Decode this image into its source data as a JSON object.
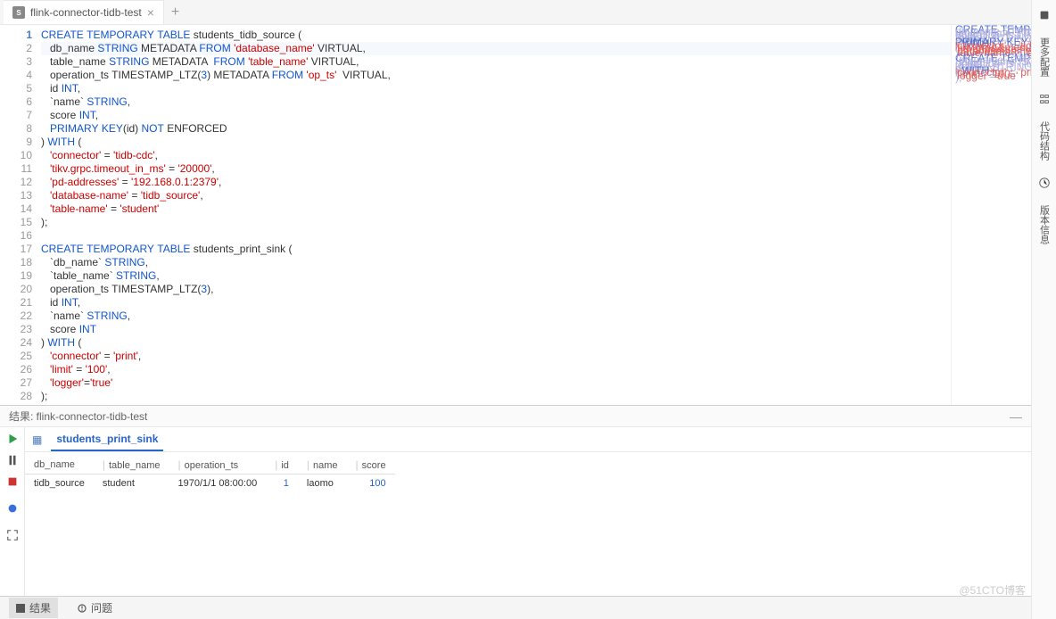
{
  "tab": {
    "title": "flink-connector-tidb-test",
    "icon_letter": "S"
  },
  "sidebar": {
    "items": [
      "更多配置",
      "代码结构",
      "版本信息"
    ]
  },
  "code_lines": [
    [
      [
        "kw",
        "CREATE"
      ],
      [
        "",
        " "
      ],
      [
        "kw",
        "TEMPORARY"
      ],
      [
        "",
        " "
      ],
      [
        "kw",
        "TABLE"
      ],
      [
        "",
        " students_tidb_source ("
      ]
    ],
    [
      [
        "",
        "   db_name "
      ],
      [
        "typ",
        "STRING"
      ],
      [
        "",
        " METADATA "
      ],
      [
        "kw",
        "FROM"
      ],
      [
        "",
        " "
      ],
      [
        "str",
        "'database_name'"
      ],
      [
        "",
        " VIRTUAL,"
      ]
    ],
    [
      [
        "",
        "   table_name "
      ],
      [
        "typ",
        "STRING"
      ],
      [
        "",
        " METADATA  "
      ],
      [
        "kw",
        "FROM"
      ],
      [
        "",
        " "
      ],
      [
        "str",
        "'table_name'"
      ],
      [
        "",
        " VIRTUAL,"
      ]
    ],
    [
      [
        "",
        "   operation_ts TIMESTAMP_LTZ("
      ],
      [
        "num",
        "3"
      ],
      [
        "",
        ") METADATA "
      ],
      [
        "kw",
        "FROM"
      ],
      [
        "",
        " "
      ],
      [
        "str",
        "'op_ts'"
      ],
      [
        "",
        "  VIRTUAL,"
      ]
    ],
    [
      [
        "",
        "   id "
      ],
      [
        "typ",
        "INT"
      ],
      [
        "",
        ","
      ]
    ],
    [
      [
        "",
        "   `name` "
      ],
      [
        "typ",
        "STRING"
      ],
      [
        "",
        ","
      ]
    ],
    [
      [
        "",
        "   score "
      ],
      [
        "typ",
        "INT"
      ],
      [
        "",
        ","
      ]
    ],
    [
      [
        "",
        "   "
      ],
      [
        "kw",
        "PRIMARY"
      ],
      [
        "",
        " "
      ],
      [
        "kw",
        "KEY"
      ],
      [
        "",
        "(id) "
      ],
      [
        "kw",
        "NOT"
      ],
      [
        "",
        " ENFORCED"
      ]
    ],
    [
      [
        "",
        ") "
      ],
      [
        "kw",
        "WITH"
      ],
      [
        "",
        " ("
      ]
    ],
    [
      [
        "",
        "   "
      ],
      [
        "str",
        "'connector'"
      ],
      [
        "",
        " = "
      ],
      [
        "str",
        "'tidb-cdc'"
      ],
      [
        "",
        ","
      ]
    ],
    [
      [
        "",
        "   "
      ],
      [
        "str",
        "'tikv.grpc.timeout_in_ms'"
      ],
      [
        "",
        " = "
      ],
      [
        "str",
        "'20000'"
      ],
      [
        "",
        ","
      ]
    ],
    [
      [
        "",
        "   "
      ],
      [
        "str",
        "'pd-addresses'"
      ],
      [
        "",
        " = "
      ],
      [
        "str",
        "'192.168.0.1:2379'"
      ],
      [
        "",
        ","
      ]
    ],
    [
      [
        "",
        "   "
      ],
      [
        "str",
        "'database-name'"
      ],
      [
        "",
        " = "
      ],
      [
        "str",
        "'tidb_source'"
      ],
      [
        "",
        ","
      ]
    ],
    [
      [
        "",
        "   "
      ],
      [
        "str",
        "'table-name'"
      ],
      [
        "",
        " = "
      ],
      [
        "str",
        "'student'"
      ]
    ],
    [
      [
        "",
        ");"
      ]
    ],
    [
      [
        "",
        ""
      ]
    ],
    [
      [
        "kw",
        "CREATE"
      ],
      [
        "",
        " "
      ],
      [
        "kw",
        "TEMPORARY"
      ],
      [
        "",
        " "
      ],
      [
        "kw",
        "TABLE"
      ],
      [
        "",
        " students_print_sink ("
      ]
    ],
    [
      [
        "",
        "   `db_name` "
      ],
      [
        "typ",
        "STRING"
      ],
      [
        "",
        ","
      ]
    ],
    [
      [
        "",
        "   `table_name` "
      ],
      [
        "typ",
        "STRING"
      ],
      [
        "",
        ","
      ]
    ],
    [
      [
        "",
        "   operation_ts TIMESTAMP_LTZ("
      ],
      [
        "num",
        "3"
      ],
      [
        "",
        "),"
      ]
    ],
    [
      [
        "",
        "   id "
      ],
      [
        "typ",
        "INT"
      ],
      [
        "",
        ","
      ]
    ],
    [
      [
        "",
        "   `name` "
      ],
      [
        "typ",
        "STRING"
      ],
      [
        "",
        ","
      ]
    ],
    [
      [
        "",
        "   score "
      ],
      [
        "typ",
        "INT"
      ]
    ],
    [
      [
        "",
        ") "
      ],
      [
        "kw",
        "WITH"
      ],
      [
        "",
        " ("
      ]
    ],
    [
      [
        "",
        "   "
      ],
      [
        "str",
        "'connector'"
      ],
      [
        "",
        " = "
      ],
      [
        "str",
        "'print'"
      ],
      [
        "",
        ","
      ]
    ],
    [
      [
        "",
        "   "
      ],
      [
        "str",
        "'limit'"
      ],
      [
        "",
        " = "
      ],
      [
        "str",
        "'100'"
      ],
      [
        "",
        ","
      ]
    ],
    [
      [
        "",
        "   "
      ],
      [
        "str",
        "'logger'"
      ],
      [
        "",
        "="
      ],
      [
        "str",
        "'true'"
      ]
    ],
    [
      [
        "",
        ");"
      ]
    ],
    [
      [
        "",
        ""
      ]
    ]
  ],
  "results": {
    "header_prefix": "结果: ",
    "header_name": "flink-connector-tidb-test",
    "tab": "students_print_sink",
    "columns": [
      "db_name",
      "table_name",
      "operation_ts",
      "id",
      "name",
      "score"
    ],
    "row": {
      "db_name": "tidb_source",
      "table_name": "student",
      "operation_ts": "1970/1/1 08:00:00",
      "id": "1",
      "name": "laomo",
      "score": "100"
    }
  },
  "bottom": {
    "results": "结果",
    "problems": "问题"
  },
  "watermark": "@51CTO博客"
}
